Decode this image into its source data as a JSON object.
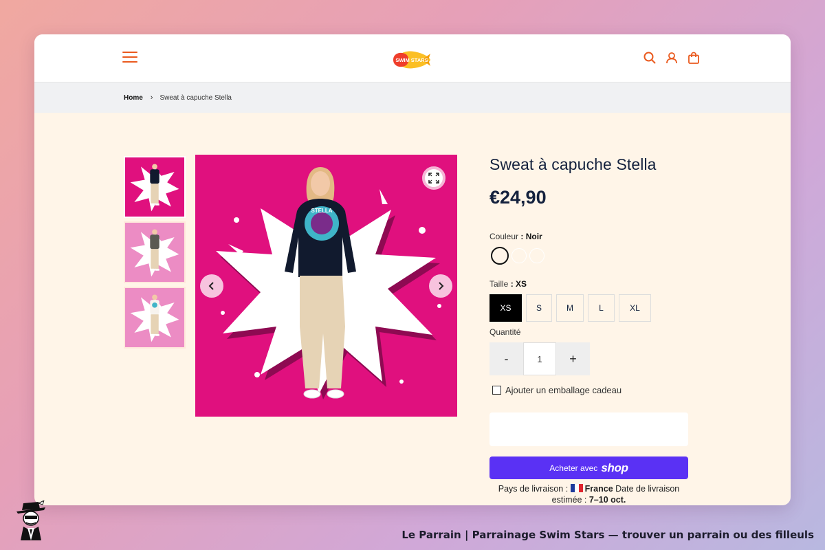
{
  "header": {
    "logo_text": "SWIM STARS",
    "brand_color": "#ea5a1e",
    "icons": [
      "menu-icon",
      "search-icon",
      "account-icon",
      "bag-icon"
    ]
  },
  "breadcrumb": {
    "home": "Home",
    "current": "Sweat à capuche Stella"
  },
  "product": {
    "title": "Sweat à capuche Stella",
    "price": "€24,90",
    "color_label": "Couleur",
    "color_value": ": Noir",
    "colors": [
      "Noir",
      "Blanc",
      "Blanc"
    ],
    "size_label": "Taille",
    "size_value": ": XS",
    "sizes": [
      "XS",
      "S",
      "M",
      "L",
      "XL"
    ],
    "selected_size": "XS",
    "quantity_label": "Quantité",
    "quantity_minus": "-",
    "quantity_value": "1",
    "quantity_plus": "+",
    "gift_label": "Ajouter un emballage cadeau",
    "buy_label": "Acheter avec",
    "buy_brand": "shop",
    "buy_color": "#5a31f4"
  },
  "shipping": {
    "country_label": "Pays de livraison :",
    "country": "France",
    "date_label": "Date de livraison estimée :",
    "date": "7–10 oct."
  },
  "gallery": {
    "thumbnails": [
      "Noir",
      "Gris",
      "Blanc"
    ],
    "hero_text": "STELLA",
    "hero_color": "#e0107e"
  },
  "footer": {
    "caption": "Le Parrain | Parrainage Swim Stars — trouver un parrain ou des filleuls"
  }
}
